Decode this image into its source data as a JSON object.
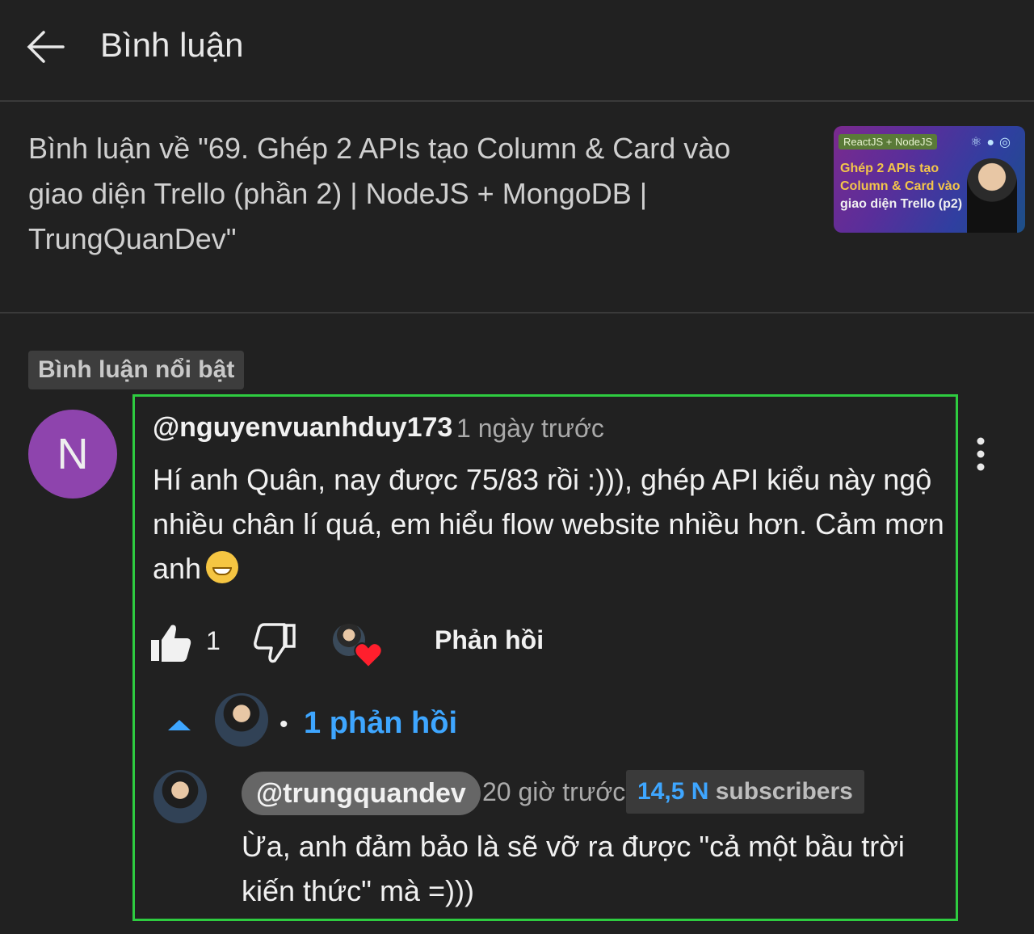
{
  "header": {
    "title": "Bình luận",
    "back_icon": "arrow-left-icon"
  },
  "video": {
    "caption": "Bình luận về \"69. Ghép 2 APIs tạo Column & Card vào giao diện Trello (phần 2) | NodeJS + MongoDB | TrungQuanDev\"",
    "thumbnail": {
      "tag": "ReactJS + NodeJS",
      "line1": "Ghép 2 APIs tạo",
      "line2": "Column & Card vào",
      "line3": "giao diện Trello (p2)"
    }
  },
  "pinned_label": "Bình luận nổi bật",
  "comment": {
    "avatar_letter": "N",
    "author": "@nguyenvuanhduy173",
    "time": "1 ngày trước",
    "text": "Hí anh Quân, nay được 75/83 rồi :))), ghép API kiểu này ngộ nhiều chân lí quá, em hiểu flow website nhiều hơn. Cảm mơn anh",
    "like_count": "1",
    "reply_label": "Phản hồi"
  },
  "replies": {
    "count_label": "1 phản hồi",
    "separator": "•",
    "items": [
      {
        "author": "@trungquandev",
        "time": "20 giờ trước",
        "subs_number": "14,5 N",
        "subs_label": "subscribers",
        "text": "Ừa, anh đảm bảo là sẽ vỡ ra được \"cả một bầu trời kiến thức\" mà =)))"
      }
    ]
  },
  "colors": {
    "background": "#212121",
    "highlight_border": "#2ecc40",
    "link_blue": "#3ea6ff",
    "avatar_purple": "#8e44ad",
    "heart_red": "#ff1f2d"
  }
}
